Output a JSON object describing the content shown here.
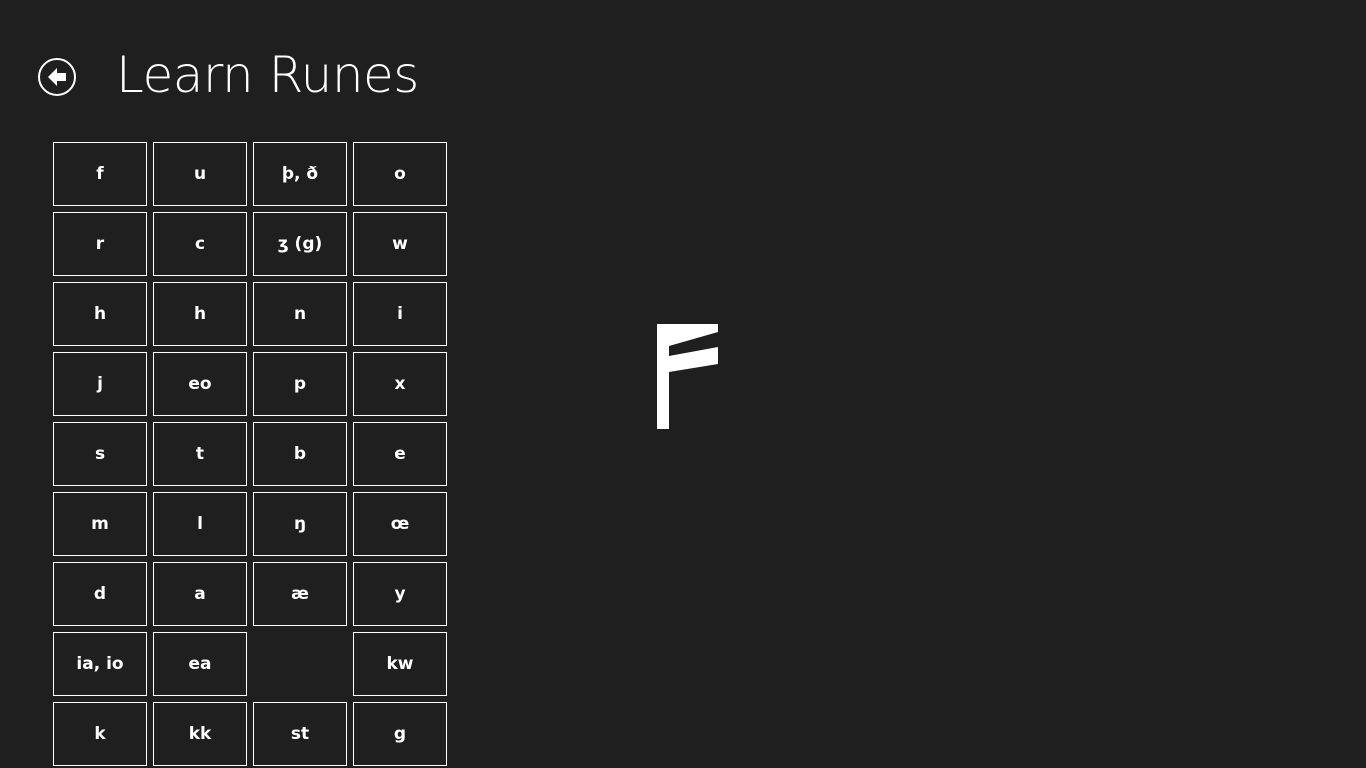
{
  "header": {
    "title": "Learn Runes",
    "back_icon": "back-arrow-icon"
  },
  "runes": [
    "f",
    "u",
    "þ, ð",
    "o",
    "r",
    "c",
    "ʒ (g)",
    "w",
    "h",
    "h",
    "n",
    "i",
    "j",
    "eo",
    "p",
    "x",
    "s",
    "t",
    "b",
    "e",
    "m",
    "l",
    "ŋ",
    "œ",
    "d",
    "a",
    "æ",
    "y",
    "ia, io",
    "ea",
    "",
    "kw",
    "k",
    "kk",
    "st",
    "g"
  ],
  "selected_rune": {
    "glyph_icon": "feoh-rune-icon",
    "sound": "f"
  },
  "colors": {
    "background": "#1f1f1f",
    "foreground": "#ffffff"
  }
}
